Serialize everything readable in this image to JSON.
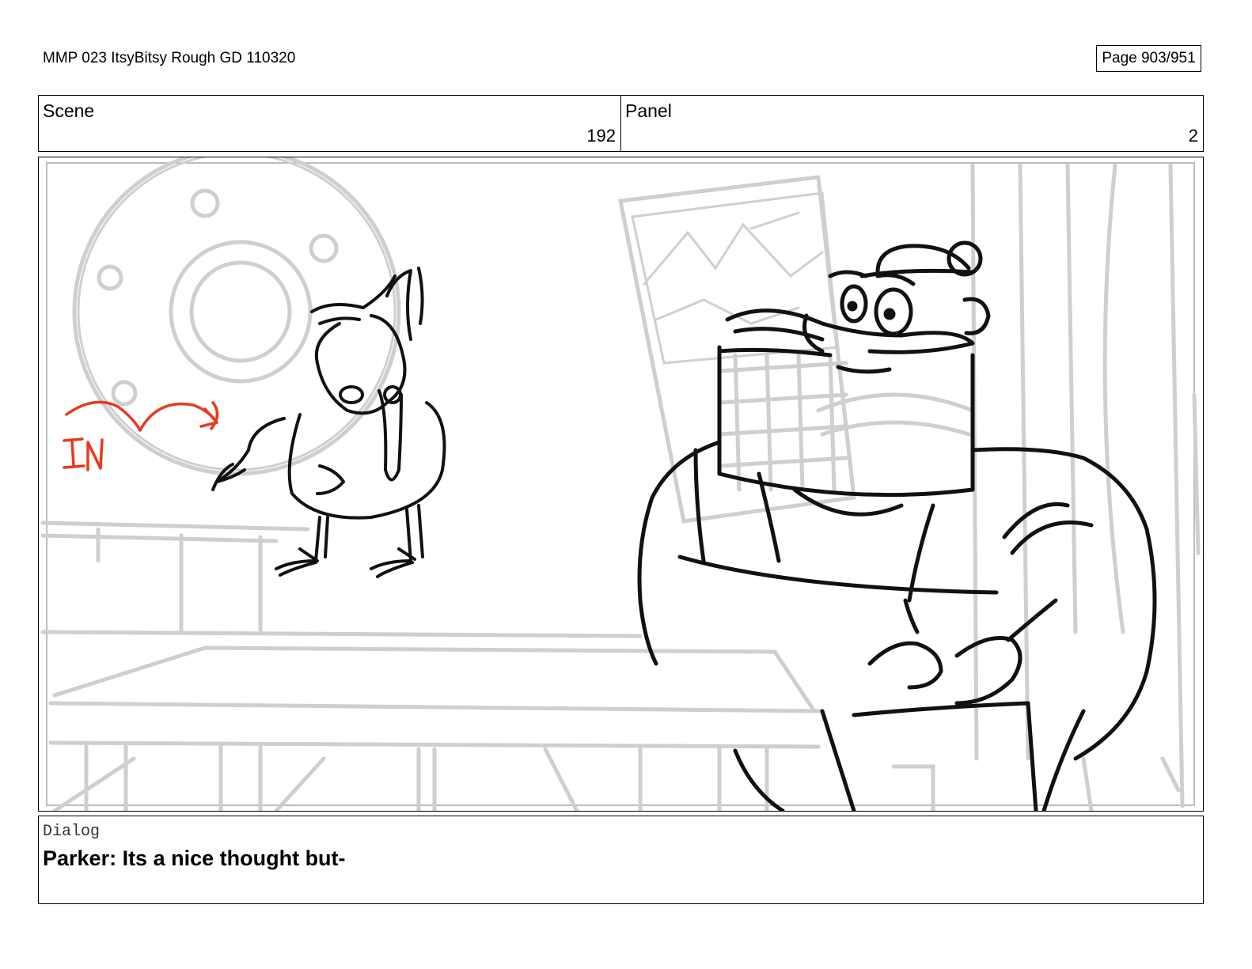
{
  "document": {
    "title": "MMP 023 ItsyBitsy Rough GD 110320",
    "page_indicator": "Page 903/951"
  },
  "header": {
    "scene_label": "Scene",
    "scene_number": "192",
    "panel_label": "Panel",
    "panel_number": "2"
  },
  "panel_art": {
    "description_icon": "storyboard-sketch",
    "annotation_text": "IN",
    "annotation_color": "#e8391c",
    "line_color": "#000000",
    "background_line_color": "#cfcfcf"
  },
  "dialog": {
    "label": "Dialog",
    "text": "Parker: Its a nice thought but-"
  }
}
